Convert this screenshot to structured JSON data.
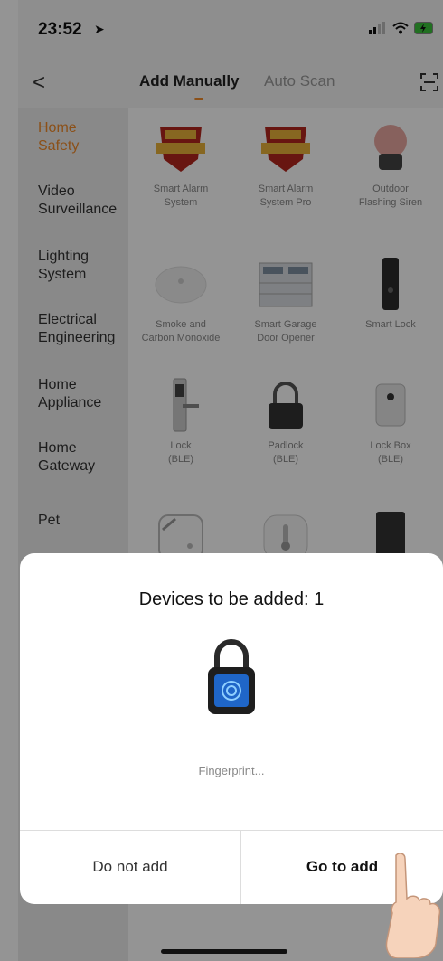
{
  "status": {
    "time": "23:52"
  },
  "nav": {
    "back": "<",
    "tabs": [
      "Add Manually",
      "Auto Scan"
    ]
  },
  "categories": [
    "Home\nSafety",
    "Video\nSurveillance",
    "Lighting\nSystem",
    "Electrical\nEngineering",
    "Home\nAppliance",
    "Home\nGateway",
    "Pet"
  ],
  "devices": [
    {
      "label": "Smart Alarm\nSystem"
    },
    {
      "label": "Smart Alarm\nSystem Pro"
    },
    {
      "label": "Outdoor\nFlashing Siren"
    },
    {
      "label": "Smoke and\nCarbon Monoxide"
    },
    {
      "label": "Smart Garage\nDoor Opener"
    },
    {
      "label": "Smart Lock"
    },
    {
      "label": "Lock\n(BLE)"
    },
    {
      "label": "Padlock\n(BLE)"
    },
    {
      "label": "Lock Box\n(BLE)"
    }
  ],
  "dialog": {
    "title": "Devices to be added: 1",
    "device_name": "Fingerprint...",
    "cancel_label": "Do not add",
    "confirm_label": "Go to add"
  },
  "colors": {
    "accent": "#f08a2a"
  }
}
